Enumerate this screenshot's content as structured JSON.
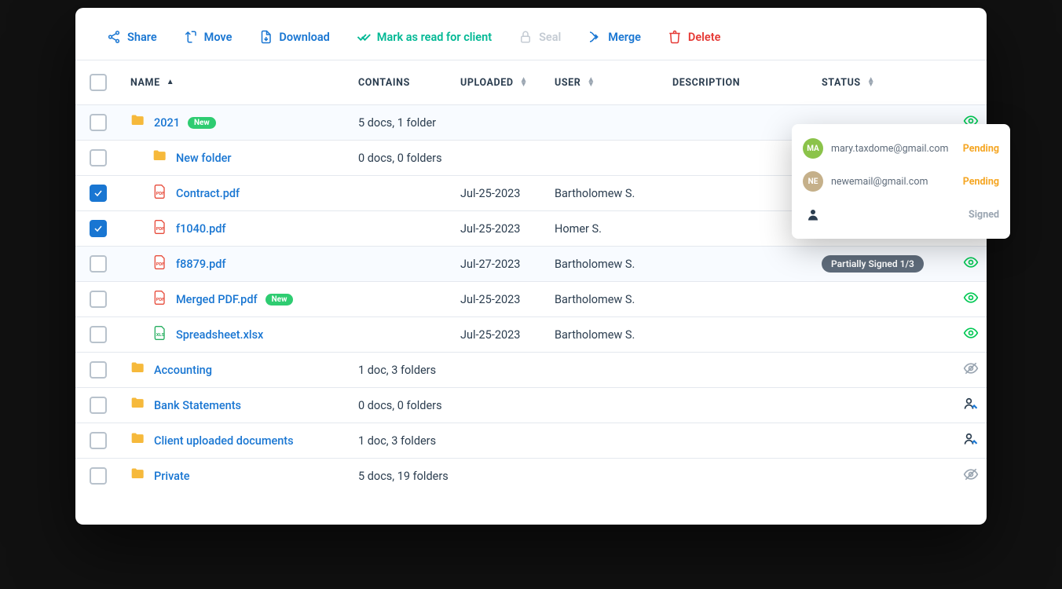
{
  "toolbar": {
    "share": "Share",
    "move": "Move",
    "download": "Download",
    "mark_read": "Mark as read for client",
    "seal": "Seal",
    "merge": "Merge",
    "delete": "Delete"
  },
  "headers": {
    "name": "NAME",
    "contains": "CONTAINS",
    "uploaded": "UPLOADED",
    "user": "USER",
    "description": "DESCRIPTION",
    "status": "STATUS"
  },
  "rows": [
    {
      "checked": false,
      "indent": 0,
      "icon": "folder",
      "name": "2021",
      "new": true,
      "contains": "5 docs, 1 folder",
      "uploaded": "",
      "user": "",
      "status": "",
      "vis": "eye-green",
      "highlight": true
    },
    {
      "checked": false,
      "indent": 1,
      "icon": "folder",
      "name": "New folder",
      "new": false,
      "contains": "0 docs, 0 folders",
      "uploaded": "",
      "user": "",
      "status": "",
      "vis": "eye-green",
      "highlight": false
    },
    {
      "checked": true,
      "indent": 1,
      "icon": "pdf",
      "name": "Contract.pdf",
      "new": false,
      "contains": "",
      "uploaded": "Jul-25-2023",
      "user": "Bartholomew S.",
      "status": "",
      "vis": "eye-green",
      "highlight": false
    },
    {
      "checked": true,
      "indent": 1,
      "icon": "pdf",
      "name": "f1040.pdf",
      "new": false,
      "contains": "",
      "uploaded": "Jul-25-2023",
      "user": "Homer S.",
      "status": "",
      "vis": "eye-green",
      "highlight": false
    },
    {
      "checked": false,
      "indent": 1,
      "icon": "pdf",
      "name": "f8879.pdf",
      "new": false,
      "contains": "",
      "uploaded": "Jul-27-2023",
      "user": "Bartholomew S.",
      "status": "Partially Signed 1/3",
      "vis": "eye-green",
      "highlight": true
    },
    {
      "checked": false,
      "indent": 1,
      "icon": "pdf",
      "name": "Merged PDF.pdf",
      "new": true,
      "contains": "",
      "uploaded": "Jul-25-2023",
      "user": "Bartholomew S.",
      "status": "",
      "vis": "eye-green",
      "highlight": false
    },
    {
      "checked": false,
      "indent": 1,
      "icon": "xls",
      "name": "Spreadsheet.xlsx",
      "new": false,
      "contains": "",
      "uploaded": "Jul-25-2023",
      "user": "Bartholomew S.",
      "status": "",
      "vis": "eye-green",
      "highlight": false
    },
    {
      "checked": false,
      "indent": 0,
      "icon": "folder",
      "name": "Accounting",
      "new": false,
      "contains": "1 doc, 3 folders",
      "uploaded": "",
      "user": "",
      "status": "",
      "vis": "eye-off",
      "highlight": false
    },
    {
      "checked": false,
      "indent": 0,
      "icon": "folder",
      "name": "Bank Statements",
      "new": false,
      "contains": "0 docs, 0 folders",
      "uploaded": "",
      "user": "",
      "status": "",
      "vis": "sign",
      "highlight": false
    },
    {
      "checked": false,
      "indent": 0,
      "icon": "folder",
      "name": "Client uploaded documents",
      "new": false,
      "contains": "1 doc, 3 folders",
      "uploaded": "",
      "user": "",
      "status": "",
      "vis": "sign",
      "highlight": false
    },
    {
      "checked": false,
      "indent": 0,
      "icon": "folder",
      "name": "Private",
      "new": false,
      "contains": "5 docs, 19 folders",
      "uploaded": "",
      "user": "",
      "status": "",
      "vis": "eye-off",
      "highlight": false
    }
  ],
  "popover": {
    "rows": [
      {
        "avatar": "MA",
        "avatarClass": "av-green",
        "email": "mary.taxdome@gmail.com",
        "status": "Pending",
        "statusClass": "pending"
      },
      {
        "avatar": "NE",
        "avatarClass": "av-beige",
        "email": "newemail@gmail.com",
        "status": "Pending",
        "statusClass": "pending"
      },
      {
        "avatar": "user",
        "avatarClass": "av-user",
        "email": "",
        "status": "Signed",
        "statusClass": "signed"
      }
    ]
  },
  "badge_new_label": "New"
}
